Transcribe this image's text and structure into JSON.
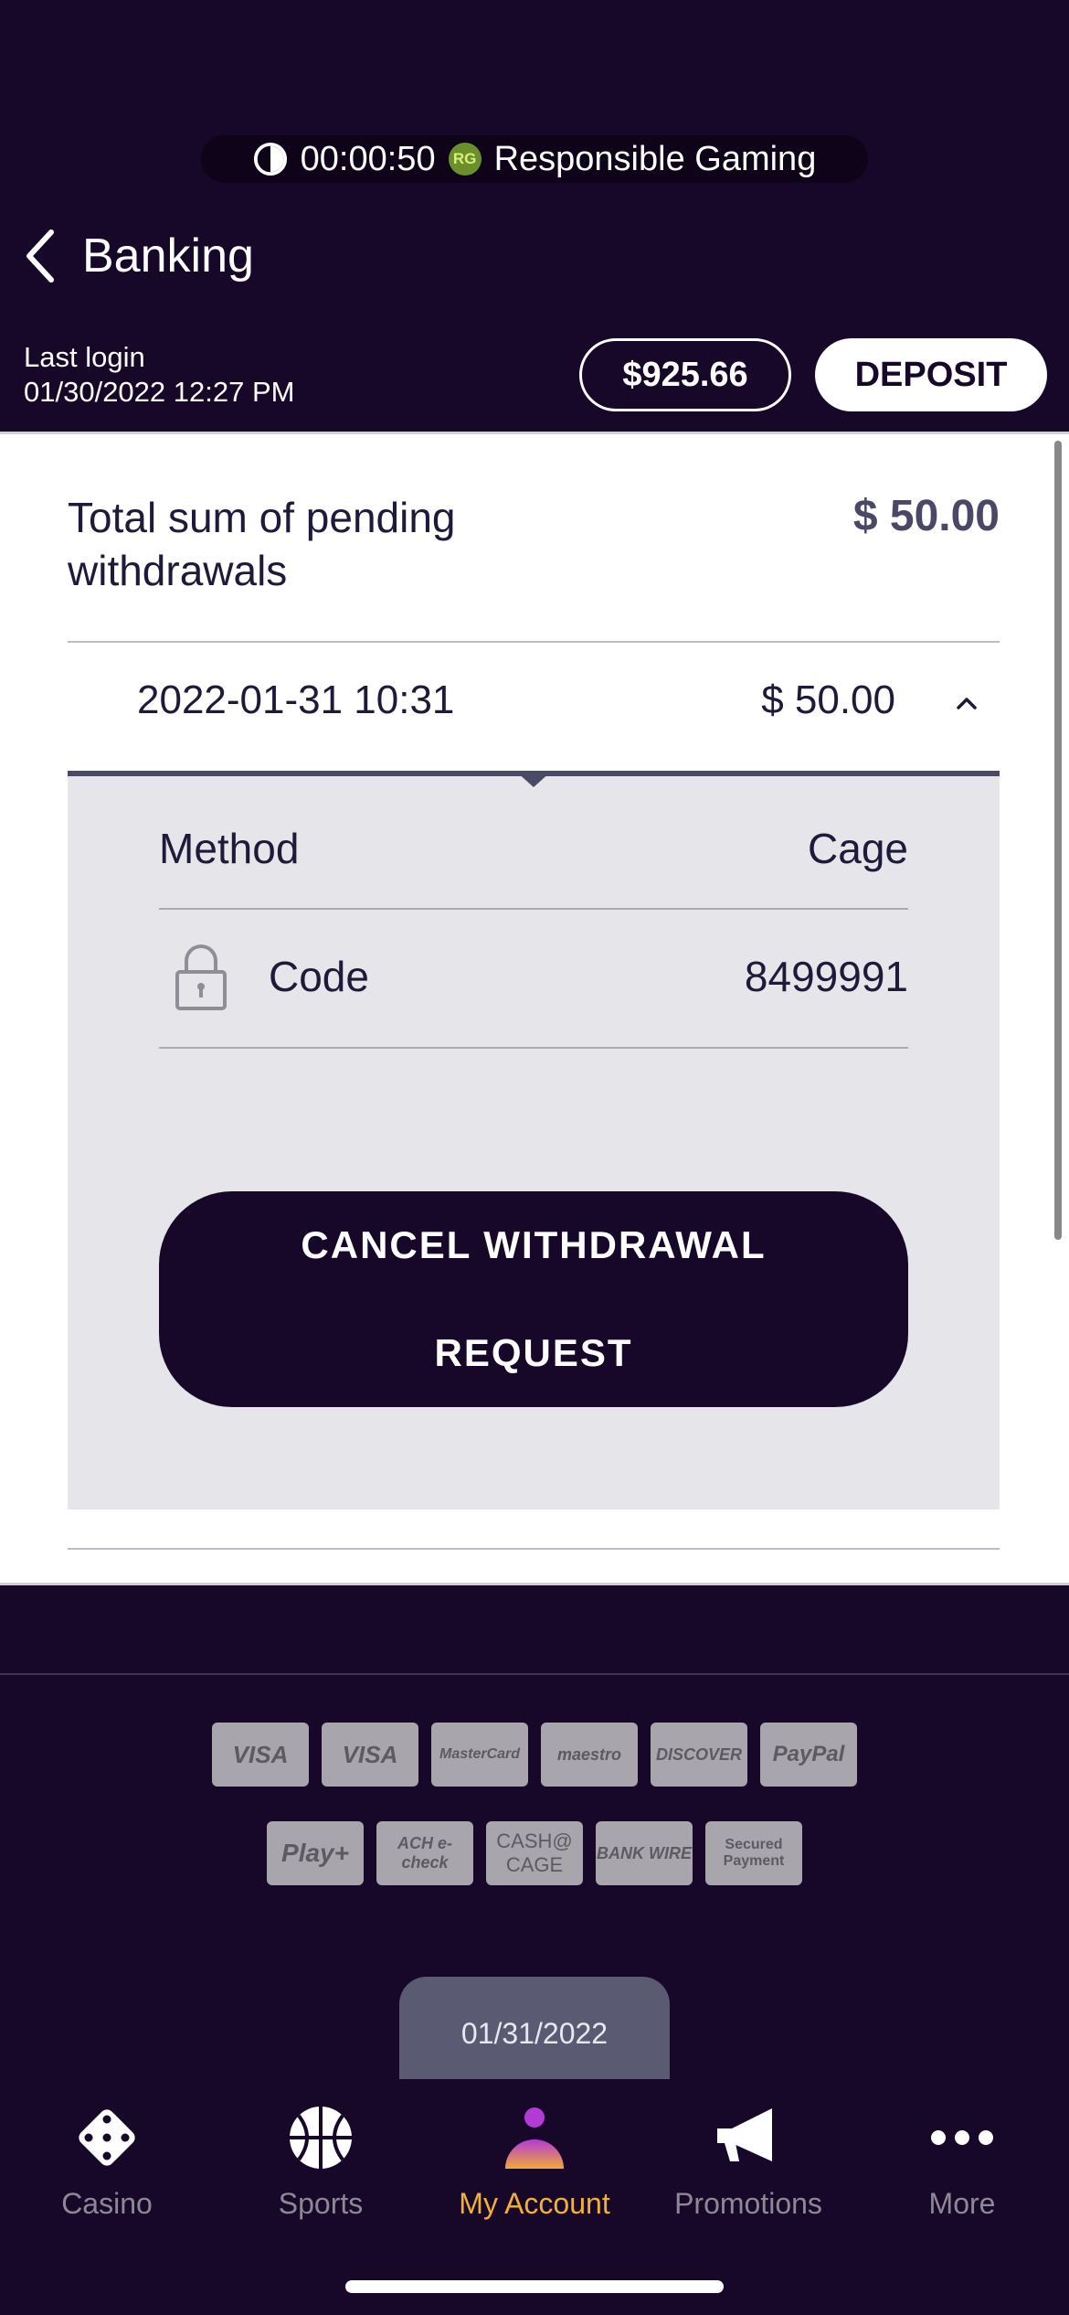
{
  "status_bar": {
    "timer": "00:00:50",
    "rg_badge": "RG",
    "rg_label": "Responsible Gaming"
  },
  "header": {
    "title": "Banking"
  },
  "account": {
    "last_login_label": "Last login",
    "last_login_value": "01/30/2022 12:27 PM",
    "balance": "$925.66",
    "deposit_label": "DEPOSIT"
  },
  "pending": {
    "label": "Total sum of pending withdrawals",
    "total": "$ 50.00",
    "row": {
      "date": "2022-01-31 10:31",
      "amount": "$ 50.00"
    },
    "detail": {
      "method_label": "Method",
      "method_value": "Cage",
      "code_label": "Code",
      "code_value": "8499991",
      "cancel_label": "CANCEL WITHDRAWAL REQUEST"
    }
  },
  "payment_methods": {
    "row1": [
      "VISA",
      "VISA",
      "MasterCard",
      "maestro",
      "DISCOVER",
      "PayPal"
    ],
    "row2": [
      "Play+",
      "ACH e-check",
      "CASH@ CAGE",
      "BANK WIRE",
      "Secured Payment"
    ]
  },
  "date_toast": "01/31/2022",
  "tabbar": {
    "items": [
      {
        "label": "Casino",
        "icon": "dice-icon"
      },
      {
        "label": "Sports",
        "icon": "basketball-icon"
      },
      {
        "label": "My Account",
        "icon": "account-icon"
      },
      {
        "label": "Promotions",
        "icon": "megaphone-icon"
      },
      {
        "label": "More",
        "icon": "more-dots-icon"
      }
    ],
    "active_index": 2,
    "active_color": "#f2b134"
  },
  "colors": {
    "background": "#170829",
    "accent": "#f2b134"
  }
}
